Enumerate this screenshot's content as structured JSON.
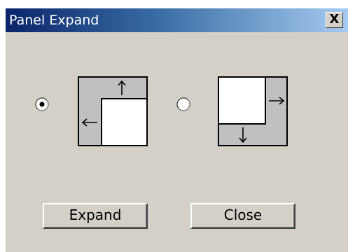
{
  "window": {
    "title": "Panel Expand",
    "close_label": "X"
  },
  "options": [
    {
      "id": "expand-up-left",
      "selected": true,
      "arrows": [
        "up-arrow",
        "left-arrow"
      ]
    },
    {
      "id": "expand-down-right",
      "selected": false,
      "arrows": [
        "right-arrow",
        "down-arrow"
      ]
    }
  ],
  "buttons": {
    "expand_label": "Expand",
    "close_label": "Close"
  }
}
